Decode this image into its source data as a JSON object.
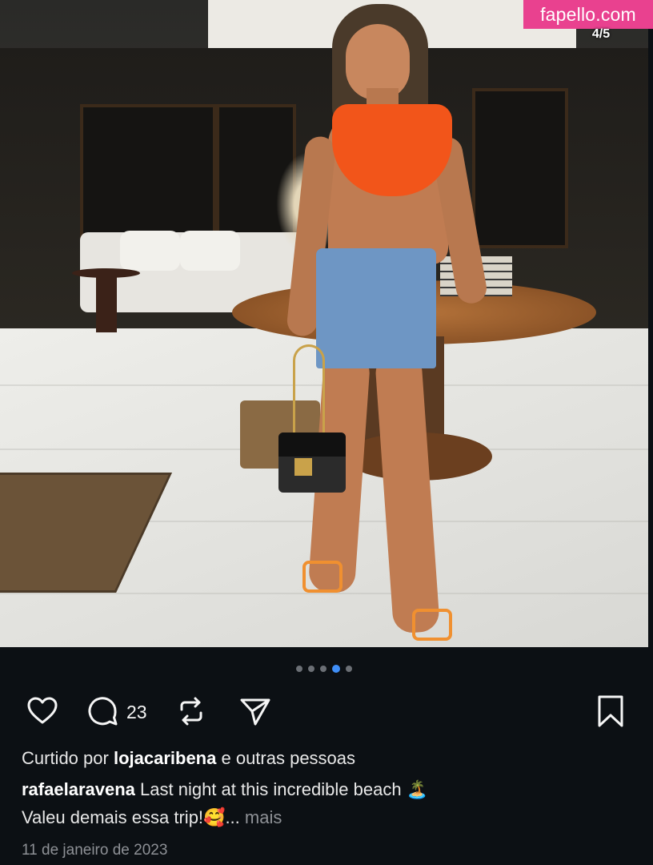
{
  "watermark": "fapello.com",
  "carousel": {
    "counter": "4/5",
    "dots": 5,
    "active_index": 3
  },
  "post": {
    "comment_count": "23",
    "likes": {
      "prefix": "Curtido por",
      "user": "lojacaribena",
      "suffix": "e outras pessoas"
    },
    "caption": {
      "author": "rafaelaravena",
      "line1": "Last night at this incredible beach 🏝️",
      "line2": "Valeu demais essa trip!🥰",
      "ellipsis": "...",
      "more_label": "mais"
    },
    "date": "11 de janeiro de 2023"
  },
  "icons": [
    "heart-icon",
    "comment-icon",
    "repost-icon",
    "send-icon",
    "bookmark-icon"
  ],
  "colors": {
    "background": "#0c1014",
    "accent": "#3f8ef7",
    "watermark": "#e9418f",
    "muted": "#8e9196"
  }
}
